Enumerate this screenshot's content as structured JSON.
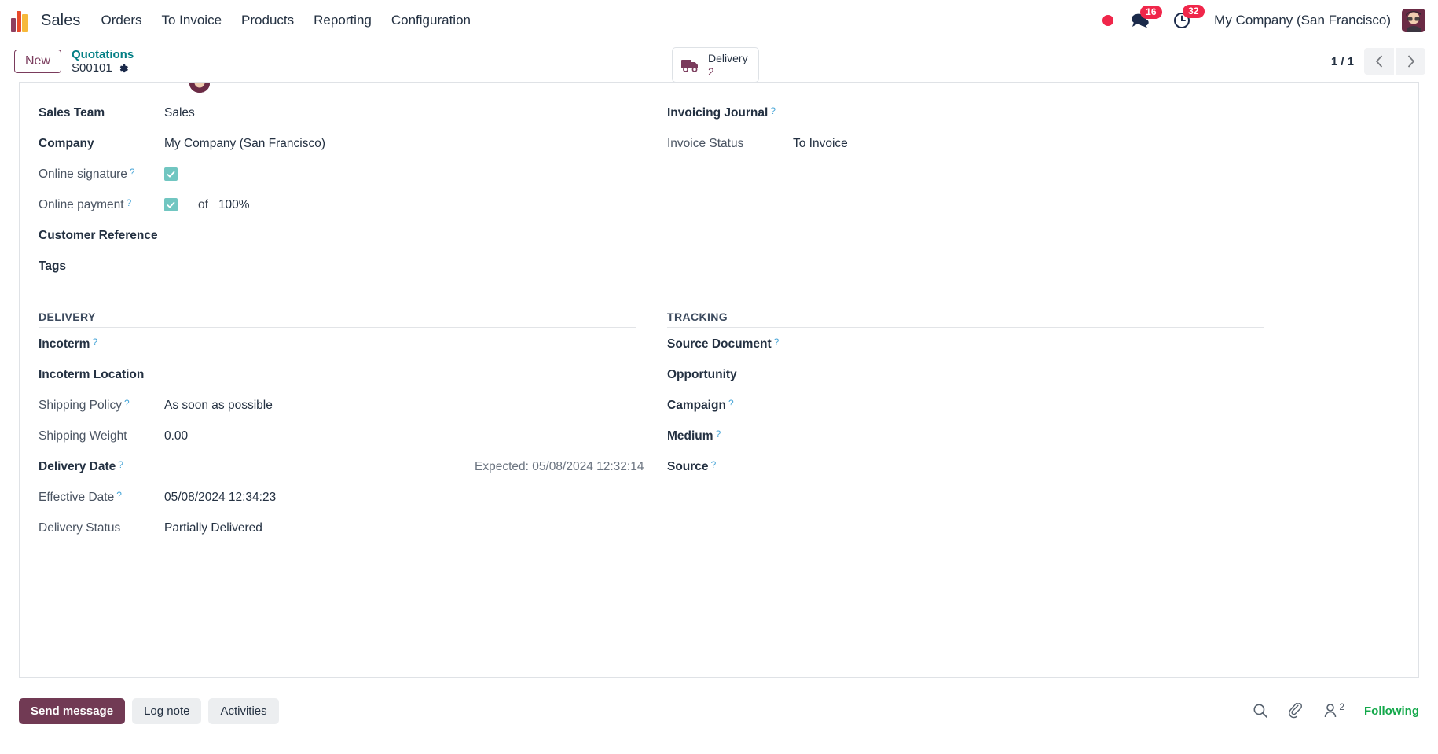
{
  "navbar": {
    "app_name": "Sales",
    "menu": [
      {
        "label": "Orders"
      },
      {
        "label": "To Invoice"
      },
      {
        "label": "Products"
      },
      {
        "label": "Reporting"
      },
      {
        "label": "Configuration"
      }
    ],
    "messages_badge": "16",
    "activities_badge": "32",
    "company": "My Company (San Francisco)",
    "icons": {
      "logo": "sales-logo-icon",
      "status_dot": "red-status-dot-icon",
      "messages": "message-bubble-icon",
      "activities": "clock-icon",
      "avatar": "user-avatar-icon"
    }
  },
  "controlpanel": {
    "new_label": "New",
    "breadcrumb_parent": "Quotations",
    "breadcrumb_current": "S00101",
    "settings_icon": "gear-icon",
    "stat_button": {
      "icon": "delivery-truck-icon",
      "label": "Delivery",
      "value": "2"
    },
    "pager": {
      "count": "1 / 1",
      "prev_icon": "chevron-left-icon",
      "next_icon": "chevron-right-icon"
    }
  },
  "form": {
    "left": {
      "fields": [
        {
          "label": "Sales Team",
          "value": "Sales",
          "bold": true,
          "tip": false
        },
        {
          "label": "Company",
          "value": "My Company (San Francisco)",
          "bold": true,
          "tip": false
        },
        {
          "label": "Online signature",
          "value": "",
          "bold": false,
          "tip": true,
          "checkbox": true
        },
        {
          "label": "Online payment",
          "value": "",
          "bold": false,
          "tip": true,
          "checkbox": true
        }
      ],
      "online_payment_of": "of",
      "online_payment_percent": "100%",
      "customer_reference_label": "Customer Reference",
      "customer_reference_value": "",
      "tags_label": "Tags",
      "tags_value": ""
    },
    "right": {
      "invoicing_journal_label": "Invoicing Journal",
      "invoicing_journal_value": "",
      "invoice_status_label": "Invoice Status",
      "invoice_status_value": "To Invoice"
    },
    "delivery": {
      "section_title": "DELIVERY",
      "rows": [
        {
          "label": "Incoterm",
          "value": "",
          "bold": true,
          "tip": true
        },
        {
          "label": "Incoterm Location",
          "value": "",
          "bold": true,
          "tip": false
        },
        {
          "label": "Shipping Policy",
          "value": "As soon as possible",
          "bold": false,
          "tip": true
        },
        {
          "label": "Shipping Weight",
          "value": "0.00",
          "bold": false,
          "tip": false
        },
        {
          "label": "Delivery Date",
          "value": "",
          "bold": true,
          "tip": true
        },
        {
          "label": "Effective Date",
          "value": "05/08/2024 12:34:23",
          "bold": false,
          "tip": true
        },
        {
          "label": "Delivery Status",
          "value": "Partially Delivered",
          "bold": false,
          "tip": false
        }
      ],
      "expected_note": "Expected: 05/08/2024 12:32:14"
    },
    "tracking": {
      "section_title": "TRACKING",
      "rows": [
        {
          "label": "Source Document",
          "value": "",
          "bold": true,
          "tip": true
        },
        {
          "label": "Opportunity",
          "value": "",
          "bold": true,
          "tip": false
        },
        {
          "label": "Campaign",
          "value": "",
          "bold": true,
          "tip": true
        },
        {
          "label": "Medium",
          "value": "",
          "bold": true,
          "tip": true
        },
        {
          "label": "Source",
          "value": "",
          "bold": true,
          "tip": true
        }
      ]
    },
    "highlight_color": "#ff0000"
  },
  "chatter": {
    "send_message": "Send message",
    "log_note": "Log note",
    "activities": "Activities",
    "search_icon": "search-icon",
    "attachment_icon": "paperclip-icon",
    "followers_icon": "user-followers-icon",
    "followers_count": "2",
    "following_label": "Following",
    "following_color": "#13a84a"
  }
}
